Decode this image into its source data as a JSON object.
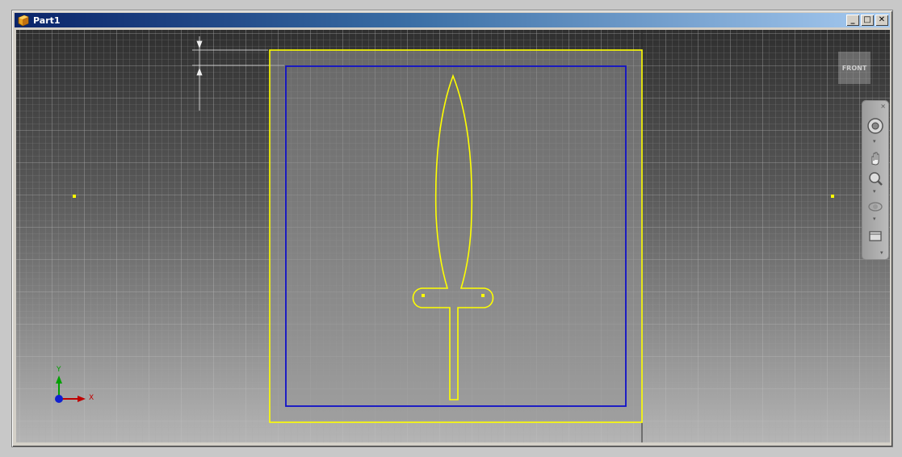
{
  "window": {
    "title": "Part1",
    "minimize_glyph": "_",
    "maximize_glyph": "□",
    "close_glyph": "✕"
  },
  "viewcube": {
    "label": "FRONT"
  },
  "navbar": {
    "close_glyph": "×",
    "items": [
      {
        "icon": "steering-wheel-icon"
      },
      {
        "icon": "pan-icon"
      },
      {
        "icon": "zoom-icon"
      },
      {
        "icon": "orbit-icon"
      },
      {
        "icon": "look-at-icon"
      }
    ]
  },
  "triad": {
    "x_label": "X",
    "y_label": "Y"
  },
  "colors": {
    "sketch_yellow": "#ffff00",
    "profile_blue": "#0000c8",
    "grid": "#9a9a9a",
    "titlebar_start": "#0a246a",
    "titlebar_end": "#a6caf0"
  }
}
